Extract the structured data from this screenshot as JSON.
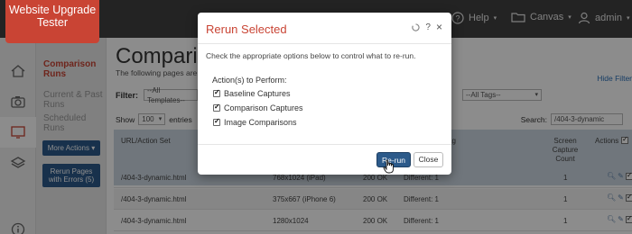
{
  "app": {
    "logo_text": "Website Upgrade Tester"
  },
  "topnav": {
    "help_label": "Help",
    "canvas_label": "Canvas",
    "user_label": "admin"
  },
  "subnav": {
    "comparison_runs": "Comparison Runs",
    "current_past_runs": "Current & Past Runs",
    "scheduled_runs": "Scheduled Runs",
    "more_actions": "More Actions",
    "rerun_pages": "Rerun Pages with Errors (5)"
  },
  "main": {
    "title": "Compariso",
    "description": "The following pages are par",
    "hide_filter": "Hide Filter",
    "filter_label": "Filter:",
    "templates_select": "--All Templates--",
    "tags_select": "--All Tags--",
    "show_label": "Show",
    "show_value": "100",
    "entries_label": "entries",
    "search_label": "Search:",
    "search_value": "/404-3-dynamic"
  },
  "table": {
    "headers": {
      "url": "URL/Action Set",
      "tag": "Tag",
      "screen_capture_count": "Screen Capture Count",
      "actions": "Actions"
    },
    "rows": [
      {
        "url": "/404-3-dynamic.html",
        "device": "768x1024 (iPad)",
        "status": "200 OK",
        "diff": "Different: 1",
        "count": "1"
      },
      {
        "url": "/404-3-dynamic.html",
        "device": "375x667 (iPhone 6)",
        "status": "200 OK",
        "diff": "Different: 1",
        "count": "1"
      },
      {
        "url": "/404-3-dynamic.html",
        "device": "1280x1024",
        "status": "200 OK",
        "diff": "Different: 1",
        "count": "1"
      }
    ]
  },
  "modal": {
    "title": "Rerun Selected",
    "description": "Check the appropriate options below to control what to re-run.",
    "actions_label": "Action(s) to Perform:",
    "options": [
      {
        "label": "Baseline Captures",
        "checked": true
      },
      {
        "label": "Comparison Captures",
        "checked": true
      },
      {
        "label": "Image Comparisons",
        "checked": true
      }
    ],
    "rerun_button": "Re-run",
    "close_button": "Close",
    "help_glyph": "?",
    "close_glyph": "×"
  },
  "colors": {
    "brand_red": "#c94434",
    "primary_blue": "#2c5a8a",
    "topbar": "#404040"
  }
}
